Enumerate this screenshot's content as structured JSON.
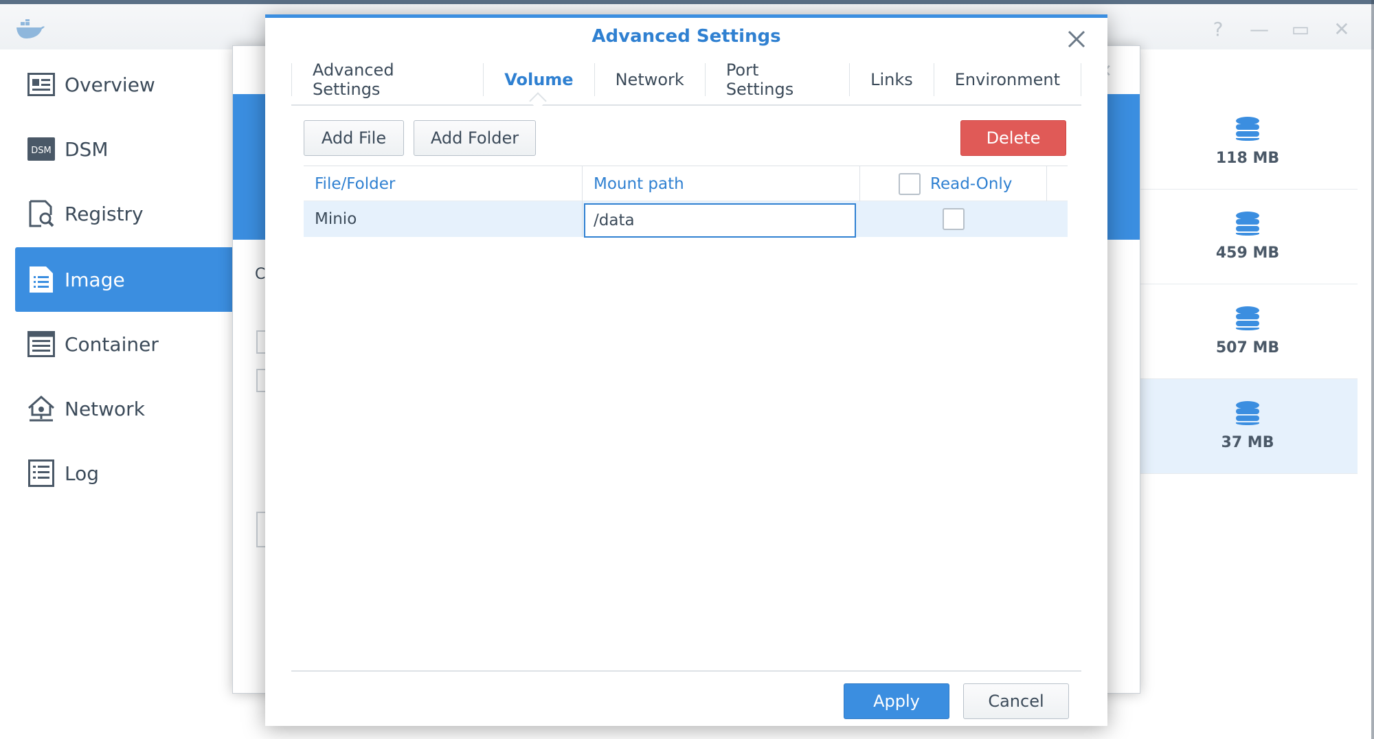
{
  "app": {
    "logo_icon": "docker-whale-icon",
    "window_controls": [
      "?",
      "—",
      "▭",
      "✕"
    ]
  },
  "sidebar": {
    "items": [
      {
        "label": "Overview",
        "icon": "overview-icon"
      },
      {
        "label": "DSM",
        "icon": "dsm-icon"
      },
      {
        "label": "Registry",
        "icon": "registry-icon"
      },
      {
        "label": "Image",
        "icon": "image-icon",
        "active": true
      },
      {
        "label": "Container",
        "icon": "container-icon"
      },
      {
        "label": "Network",
        "icon": "network-icon"
      },
      {
        "label": "Log",
        "icon": "log-icon"
      }
    ]
  },
  "image_list": {
    "sizes": [
      "118 MB",
      "459 MB",
      "507 MB",
      "37 MB"
    ]
  },
  "background_dialog": {
    "partial_text": "C"
  },
  "dialog": {
    "title": "Advanced Settings",
    "tabs": [
      "Advanced Settings",
      "Volume",
      "Network",
      "Port Settings",
      "Links",
      "Environment"
    ],
    "active_tab": "Volume",
    "toolbar": {
      "add_file": "Add File",
      "add_folder": "Add Folder",
      "delete": "Delete"
    },
    "grid": {
      "columns": [
        "File/Folder",
        "Mount path",
        "Read-Only"
      ],
      "rows": [
        {
          "file_folder": "Minio",
          "mount_path": "/data",
          "read_only": false
        }
      ]
    },
    "footer": {
      "apply": "Apply",
      "cancel": "Cancel"
    }
  },
  "colors": {
    "accent": "#3b8ee0",
    "title_blue": "#2f80d1",
    "danger": "#e05a57",
    "selected_row": "#e6f1fc"
  }
}
